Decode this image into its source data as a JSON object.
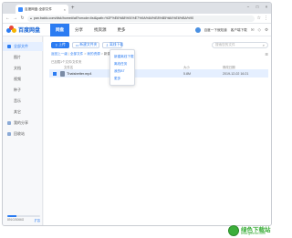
{
  "browser": {
    "tab_title": "百度网盘-全部文件",
    "tab_close": "×",
    "new_tab": "+",
    "url": "pan.baidu.com/disk/home#/all?vmode=list&path=%2F%E6%88%91%E7%9A%84%E8%B5%84%E6%BA%90",
    "window_buttons": [
      "−",
      "□",
      "×"
    ]
  },
  "app": {
    "logo_text": "百度网盘",
    "nav_tabs": [
      {
        "label": "网盘",
        "active": true
      },
      {
        "label": "分享",
        "active": false
      },
      {
        "label": "找资源",
        "active": false
      },
      {
        "label": "更多",
        "active": false
      }
    ],
    "user_name": "百度一下就知道",
    "client_download": "客户端下载"
  },
  "sidebar": {
    "items": [
      {
        "label": "全部文件",
        "active": true,
        "sub": false
      },
      {
        "label": "图片",
        "active": false,
        "sub": true
      },
      {
        "label": "文档",
        "active": false,
        "sub": true
      },
      {
        "label": "视频",
        "active": false,
        "sub": true
      },
      {
        "label": "种子",
        "active": false,
        "sub": true
      },
      {
        "label": "音乐",
        "active": false,
        "sub": true
      },
      {
        "label": "其它",
        "active": false,
        "sub": true
      },
      {
        "label": "我的分享",
        "active": false,
        "sub": false
      },
      {
        "label": "回收站",
        "active": false,
        "sub": false
      }
    ],
    "storage_used": "891G/3066G",
    "storage_fraction": 0.29,
    "expand_label": "扩容"
  },
  "toolbar": {
    "upload": "上传",
    "new_folder": "新建文件夹",
    "offline_download": "离线下载",
    "search_placeholder": "搜索您的文件"
  },
  "dropdown": {
    "items": [
      "新建离线下载",
      "离线任务",
      "我的BT",
      "更多"
    ]
  },
  "breadcrumb": {
    "back": "返回上一级",
    "root": "全部文件",
    "parent": "我的资源",
    "current": "新建文件夹"
  },
  "list": {
    "loaded_text": "已加载1个文件/文件夹",
    "columns": {
      "name": "文件名",
      "size": "大小",
      "date": "修改日期"
    },
    "rows": [
      {
        "name": "Thatsbetter.mp4",
        "size": "5.8M",
        "date": "2019-12-02 16:21"
      }
    ]
  },
  "watermark": {
    "text": "绿色下载站",
    "sub": "www.greenxf.com"
  },
  "colors": {
    "accent": "#2b7cf2",
    "logo": "#1a66d6",
    "selected_row": "#e5efff",
    "watermark": "#3cae3a"
  }
}
